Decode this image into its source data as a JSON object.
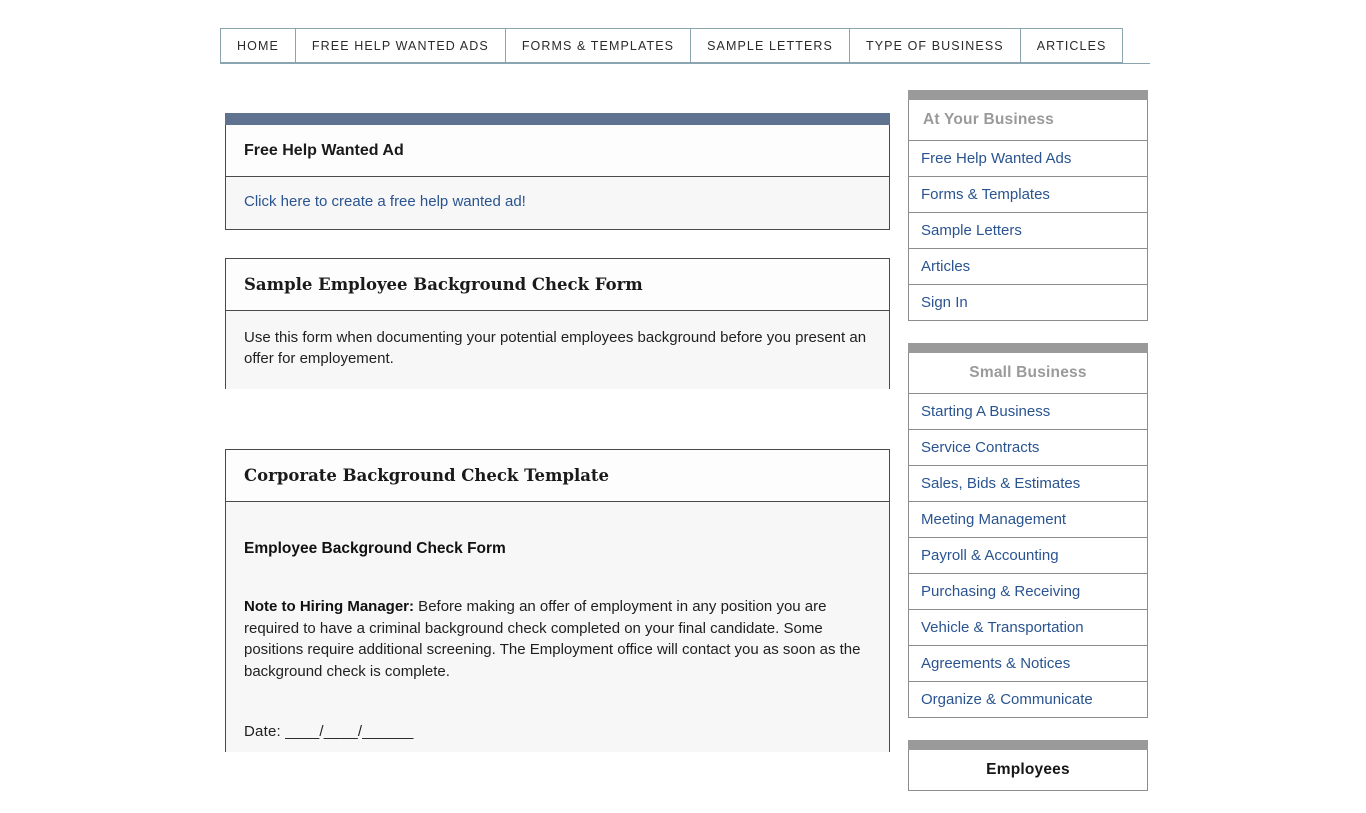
{
  "nav": {
    "items": [
      {
        "label": "HOME",
        "name": "nav-tab-home"
      },
      {
        "label": "FREE HELP WANTED ADS",
        "name": "nav-tab-free-help-wanted-ads"
      },
      {
        "label": "FORMS & TEMPLATES",
        "name": "nav-tab-forms-templates"
      },
      {
        "label": "SAMPLE LETTERS",
        "name": "nav-tab-sample-letters"
      },
      {
        "label": "TYPE OF BUSINESS",
        "name": "nav-tab-type-of-business"
      },
      {
        "label": "ARTICLES",
        "name": "nav-tab-articles"
      }
    ]
  },
  "main": {
    "panel1": {
      "title": "Free Help Wanted Ad",
      "link": "Click here to create a free help wanted ad!"
    },
    "panel2": {
      "title": "Sample Employee Background Check Form",
      "body": "Use this form when documenting your potential employees background before you present an offer for employement."
    },
    "panel3": {
      "title": "Corporate Background Check Template",
      "form_heading": "Employee Background Check Form",
      "note_label": "Note to Hiring Manager:",
      "note_body": " Before making an offer of employment in any position you are required to have a criminal background check completed on your final candidate. Some positions require additional screening. The Employment office will contact you as soon as the background check is complete.",
      "date_line": "Date:  ____/____/______"
    }
  },
  "sidebar": {
    "block1": {
      "heading": "At Your Business",
      "items": [
        "Free Help Wanted Ads",
        "Forms & Templates",
        "Sample Letters",
        "Articles",
        "Sign In"
      ]
    },
    "block2": {
      "heading": "Small Business",
      "items": [
        "Starting A Business",
        "Service Contracts",
        "Sales, Bids & Estimates",
        "Meeting Management",
        "Payroll & Accounting",
        "Purchasing & Receiving",
        "Vehicle & Transportation",
        "Agreements & Notices",
        "Organize & Communicate"
      ]
    },
    "block3": {
      "heading": "Employees"
    }
  },
  "colors": {
    "panel_accent": "#5f7391",
    "sidebar_accent": "#9a9a9a",
    "link": "#2a5490",
    "nav_border": "#8aa5b0"
  }
}
